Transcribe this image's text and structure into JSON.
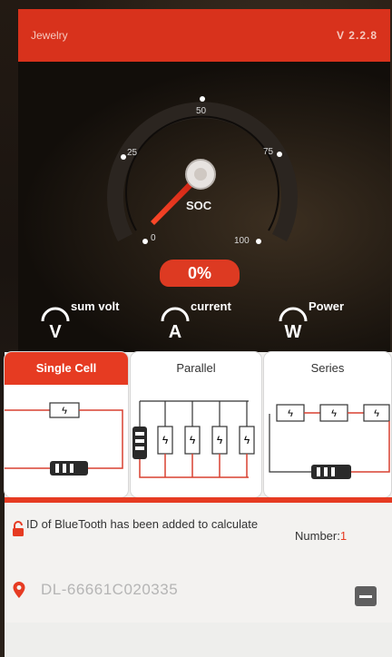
{
  "header": {
    "title": "Jewelry",
    "version": "V 2.2.8"
  },
  "gauge": {
    "soc_label": "SOC",
    "ticks": [
      "0",
      "25",
      "50",
      "75",
      "100"
    ],
    "percent": "0%",
    "percent_value": 0
  },
  "meters": [
    {
      "label": "sum volt",
      "glyph": "V"
    },
    {
      "label": "current",
      "glyph": "A"
    },
    {
      "label": "Power",
      "glyph": "W"
    }
  ],
  "modes": {
    "single": "Single Cell",
    "parallel": "Parallel",
    "series": "Series",
    "active": "Single Cell"
  },
  "bt": {
    "message": "ID of BlueTooth has been added to calculate",
    "number_label": "Number:",
    "number_value": "1"
  },
  "device": {
    "id": "DL-66661C020335"
  },
  "colors": {
    "accent": "#e63b22",
    "header": "#d8321c",
    "dark": "#1b1410"
  },
  "icons": {
    "lock": "lock-icon",
    "pin": "location-pin-icon",
    "remove": "minus-icon",
    "battery": "battery-icon",
    "cell": "lightning-cell-icon"
  }
}
